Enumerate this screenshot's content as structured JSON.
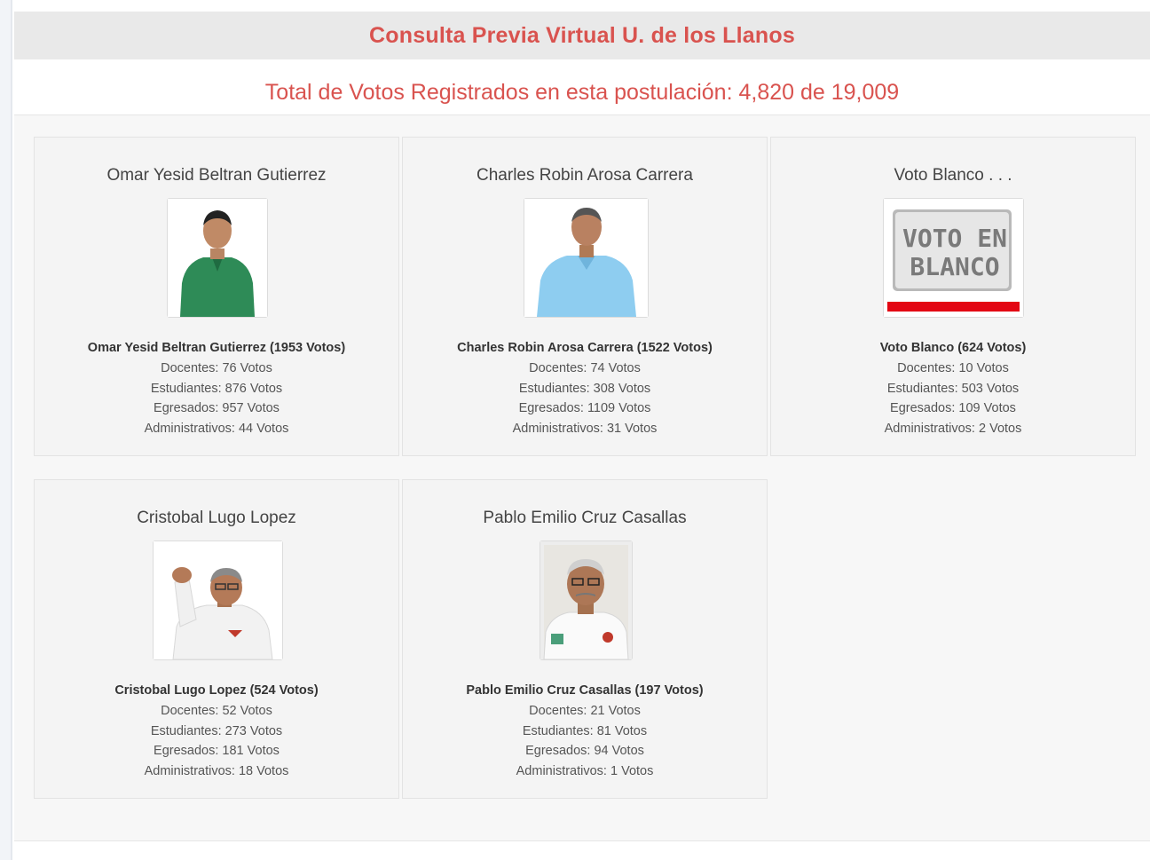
{
  "header": {
    "title": "Consulta Previa Virtual U. de los Llanos"
  },
  "summary": {
    "total_line": "Total de Votos Registrados en esta postulación: 4,820 de 19,009"
  },
  "colors": {
    "accent": "#d9534f",
    "header_bg": "#e9e9e9",
    "panel_bg": "#f7f7f7"
  },
  "candidates": [
    {
      "name": "Omar Yesid Beltran Gutierrez",
      "photo": "candidate-photo-green-shirt",
      "summary": "Omar Yesid Beltran Gutierrez (1953 Votos)",
      "docentes": "Docentes: 76 Votos",
      "estudiantes": "Estudiantes: 876 Votos",
      "egresados": "Egresados: 957 Votos",
      "administrativos": "Administrativos: 44 Votos"
    },
    {
      "name": "Charles Robin Arosa Carrera",
      "photo": "candidate-photo-blue-shirt",
      "summary": "Charles Robin Arosa Carrera (1522 Votos)",
      "docentes": "Docentes: 74 Votos",
      "estudiantes": "Estudiantes: 308 Votos",
      "egresados": "Egresados: 1109 Votos",
      "administrativos": "Administrativos: 31 Votos"
    },
    {
      "name": "Voto Blanco . . .",
      "photo_text_1": "VOTO EN",
      "photo_text_2": "BLANCO",
      "summary": "Voto Blanco (624 Votos)",
      "docentes": "Docentes: 10 Votos",
      "estudiantes": "Estudiantes: 503 Votos",
      "egresados": "Egresados: 109 Votos",
      "administrativos": "Administrativos: 2 Votos"
    },
    {
      "name": "Cristobal Lugo Lopez",
      "photo": "candidate-photo-raised-fist",
      "summary": "Cristobal Lugo Lopez (524 Votos)",
      "docentes": "Docentes: 52 Votos",
      "estudiantes": "Estudiantes: 273 Votos",
      "egresados": "Egresados: 181 Votos",
      "administrativos": "Administrativos: 18 Votos"
    },
    {
      "name": "Pablo Emilio Cruz Casallas",
      "photo": "candidate-photo-white-shirt",
      "summary": "Pablo Emilio Cruz Casallas (197 Votos)",
      "docentes": "Docentes: 21 Votos",
      "estudiantes": "Estudiantes: 81 Votos",
      "egresados": "Egresados: 94 Votos",
      "administrativos": "Administrativos: 1 Votos"
    }
  ]
}
